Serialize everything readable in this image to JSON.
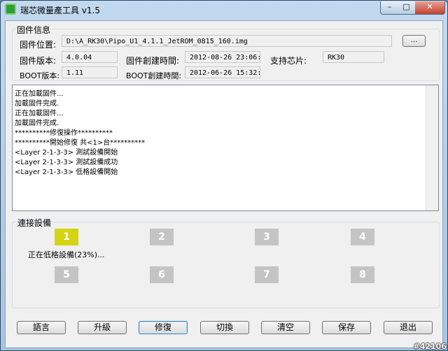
{
  "window": {
    "title": "瑞芯微量產工具 v1.5",
    "controls": {
      "minimize": "–",
      "maximize": "□",
      "close": "✕"
    }
  },
  "firmware": {
    "group_title": "固件信息",
    "location_label": "固件位置:",
    "location_value": "D:\\A_RK30\\Pipo_U1_4.1.1_JetROM_0815_160.img",
    "browse_label": "...",
    "version_label": "固件版本:",
    "version_value": "4.0.04",
    "create_time_label": "固件創建時間:",
    "create_time_value": "2012-08-26 23:06:43",
    "chip_label": "支持芯片:",
    "chip_value": "RK30",
    "boot_version_label": "BOOT版本:",
    "boot_version_value": "1.11",
    "boot_time_label": "BOOT創建時間:",
    "boot_time_value": "2012-06-26 15:32:00"
  },
  "log": [
    "正在加載固件...",
    "加載固件完成.",
    "正在加載固件...",
    "加載固件完成.",
    "**********修復操作**********",
    "**********開始修復 共<1>台**********",
    "<Layer 2-1-3-3> 測試設備開始",
    "<Layer 2-1-3-3> 測試設備成功",
    "<Layer 2-1-3-3> 低格設備開始"
  ],
  "devices": {
    "group_title": "連接設備",
    "slots": [
      "1",
      "2",
      "3",
      "4",
      "5",
      "6",
      "7",
      "8"
    ],
    "active_slot": "1",
    "active_color": "#d4d412",
    "inactive_color": "#c4c4c4",
    "status_text": "正在低格設備(23%)..."
  },
  "buttons": {
    "language": "語言",
    "upgrade": "升級",
    "repair": "修復",
    "switch": "切換",
    "clear": "清空",
    "save": "保存",
    "exit": "退出"
  },
  "watermark": "#42106"
}
